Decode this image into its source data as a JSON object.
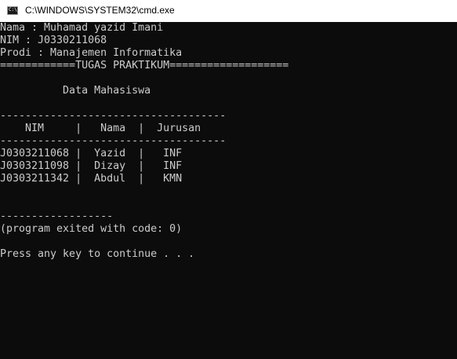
{
  "window": {
    "title": "C:\\WINDOWS\\SYSTEM32\\cmd.exe",
    "icon": "cmd-console-icon",
    "icon_glyph": "C:\\"
  },
  "console": {
    "lines": [
      "Nama : Muhamad yazid Imani",
      "NIM : J0330211068",
      "Prodi : Manajemen Informatika",
      "============TUGAS PRAKTIKUM===================",
      "",
      "          Data Mahasiswa",
      "",
      "------------------------------------",
      "    NIM     |   Nama  |  Jurusan",
      "------------------------------------",
      "J0303211068 |  Yazid  |   INF",
      "J0303211098 |  Dizay  |   INF",
      "J0303211342 |  Abdul  |   KMN",
      "",
      "",
      "",
      "------------------",
      "(program exited with code: 0)",
      "",
      "Press any key to continue . . ."
    ]
  },
  "colors": {
    "console_background": "#0c0c0c",
    "console_text": "#cccccc",
    "titlebar_background": "#ffffff",
    "titlebar_text": "#000000"
  }
}
